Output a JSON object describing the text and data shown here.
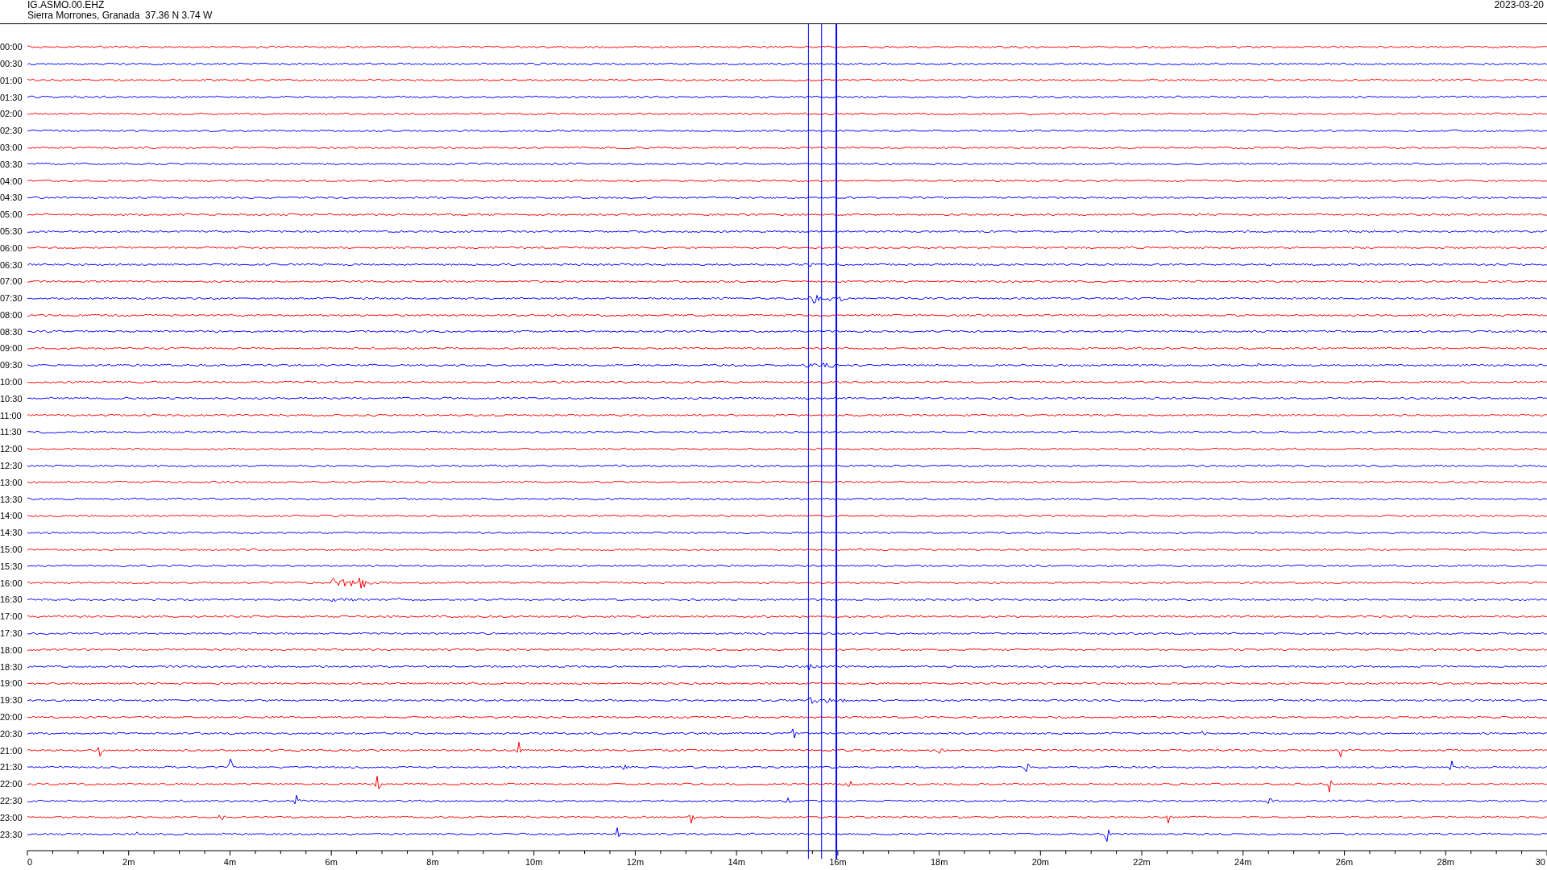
{
  "header": {
    "station": "IG.ASMO.00.EHZ",
    "location": "Sierra Morrones, Granada  37.36 N 3.74 W",
    "date": "2023-03-20"
  },
  "traces": [
    {
      "time": "00:00",
      "color": "#ff0000"
    },
    {
      "time": "00:30",
      "color": "#0000ff"
    },
    {
      "time": "01:00",
      "color": "#ff0000"
    },
    {
      "time": "01:30",
      "color": "#0000ff"
    },
    {
      "time": "02:00",
      "color": "#ff0000"
    },
    {
      "time": "02:30",
      "color": "#0000ff"
    },
    {
      "time": "03:00",
      "color": "#ff0000"
    },
    {
      "time": "03:30",
      "color": "#0000ff"
    },
    {
      "time": "04:00",
      "color": "#ff0000"
    },
    {
      "time": "04:30",
      "color": "#0000ff"
    },
    {
      "time": "05:00",
      "color": "#ff0000"
    },
    {
      "time": "05:30",
      "color": "#0000ff"
    },
    {
      "time": "06:00",
      "color": "#ff0000"
    },
    {
      "time": "06:30",
      "color": "#0000ff"
    },
    {
      "time": "07:00",
      "color": "#ff0000"
    },
    {
      "time": "07:30",
      "color": "#0000ff"
    },
    {
      "time": "08:00",
      "color": "#ff0000"
    },
    {
      "time": "08:30",
      "color": "#0000ff"
    },
    {
      "time": "09:00",
      "color": "#ff0000"
    },
    {
      "time": "09:30",
      "color": "#0000ff"
    },
    {
      "time": "10:00",
      "color": "#ff0000"
    },
    {
      "time": "10:30",
      "color": "#0000ff"
    },
    {
      "time": "11:00",
      "color": "#ff0000"
    },
    {
      "time": "11:30",
      "color": "#0000ff"
    },
    {
      "time": "12:00",
      "color": "#ff0000"
    },
    {
      "time": "12:30",
      "color": "#0000ff"
    },
    {
      "time": "13:00",
      "color": "#ff0000"
    },
    {
      "time": "13:30",
      "color": "#0000ff"
    },
    {
      "time": "14:00",
      "color": "#ff0000"
    },
    {
      "time": "14:30",
      "color": "#0000ff"
    },
    {
      "time": "15:00",
      "color": "#ff0000"
    },
    {
      "time": "15:30",
      "color": "#0000ff"
    },
    {
      "time": "16:00",
      "color": "#ff0000"
    },
    {
      "time": "16:30",
      "color": "#0000ff"
    },
    {
      "time": "17:00",
      "color": "#ff0000"
    },
    {
      "time": "17:30",
      "color": "#0000ff"
    },
    {
      "time": "18:00",
      "color": "#ff0000"
    },
    {
      "time": "18:30",
      "color": "#0000ff"
    },
    {
      "time": "19:00",
      "color": "#ff0000"
    },
    {
      "time": "19:30",
      "color": "#0000ff"
    },
    {
      "time": "20:00",
      "color": "#ff0000"
    },
    {
      "time": "20:30",
      "color": "#0000ff"
    },
    {
      "time": "21:00",
      "color": "#ff0000"
    },
    {
      "time": "21:30",
      "color": "#0000ff"
    },
    {
      "time": "22:00",
      "color": "#ff0000"
    },
    {
      "time": "22:30",
      "color": "#0000ff"
    },
    {
      "time": "23:00",
      "color": "#ff0000"
    },
    {
      "time": "23:30",
      "color": "#0000ff"
    }
  ],
  "time_axis": {
    "labels": [
      "0",
      "2m",
      "4m",
      "6m",
      "8m",
      "10m",
      "12m",
      "14m",
      "16m",
      "18m",
      "20m",
      "22m",
      "24m",
      "26m",
      "28m",
      "30"
    ]
  }
}
